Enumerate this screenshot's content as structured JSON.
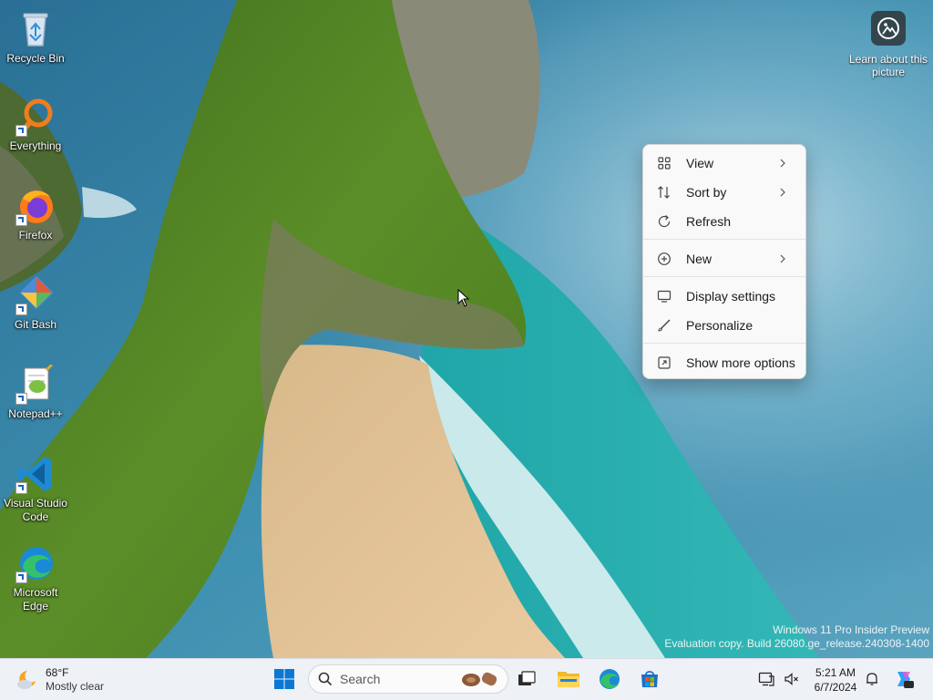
{
  "desktop": {
    "icons": [
      {
        "label": "Recycle Bin",
        "icon": "recycle-bin-icon"
      },
      {
        "label": "Everything",
        "icon": "everything-search-icon"
      },
      {
        "label": "Firefox",
        "icon": "firefox-icon"
      },
      {
        "label": "Git Bash",
        "icon": "git-bash-icon"
      },
      {
        "label": "Notepad++",
        "icon": "notepad-plus-plus-icon"
      },
      {
        "label": "Visual Studio Code",
        "icon": "vscode-icon"
      },
      {
        "label": "Microsoft Edge",
        "icon": "edge-icon"
      }
    ],
    "learn_about_picture": "Learn about this picture"
  },
  "context_menu": {
    "items": [
      {
        "label": "View",
        "icon": "grid-view-icon",
        "has_submenu": true
      },
      {
        "label": "Sort by",
        "icon": "sort-icon",
        "has_submenu": true
      },
      {
        "label": "Refresh",
        "icon": "refresh-icon",
        "has_submenu": false
      },
      {
        "label": "New",
        "icon": "new-plus-icon",
        "has_submenu": true
      },
      {
        "label": "Display settings",
        "icon": "display-icon",
        "has_submenu": false
      },
      {
        "label": "Personalize",
        "icon": "brush-icon",
        "has_submenu": false
      },
      {
        "label": "Show more options",
        "icon": "expand-icon",
        "has_submenu": false
      }
    ]
  },
  "watermark": {
    "line1": "Windows 11 Pro Insider Preview",
    "line2": "Evaluation copy. Build 26080.ge_release.240308-1400"
  },
  "taskbar": {
    "weather": {
      "temp": "68°F",
      "condition": "Mostly clear"
    },
    "search_placeholder": "Search",
    "pinned": [
      "windows-start-icon",
      "task-view-icon",
      "file-explorer-icon",
      "edge-icon",
      "microsoft-store-icon"
    ],
    "clock": {
      "time": "5:21 AM",
      "date": "6/7/2024"
    }
  },
  "colors": {
    "accent": "#0067c0",
    "menu_bg": "#f9f9f9",
    "taskbar_bg": "#eef1f5"
  }
}
